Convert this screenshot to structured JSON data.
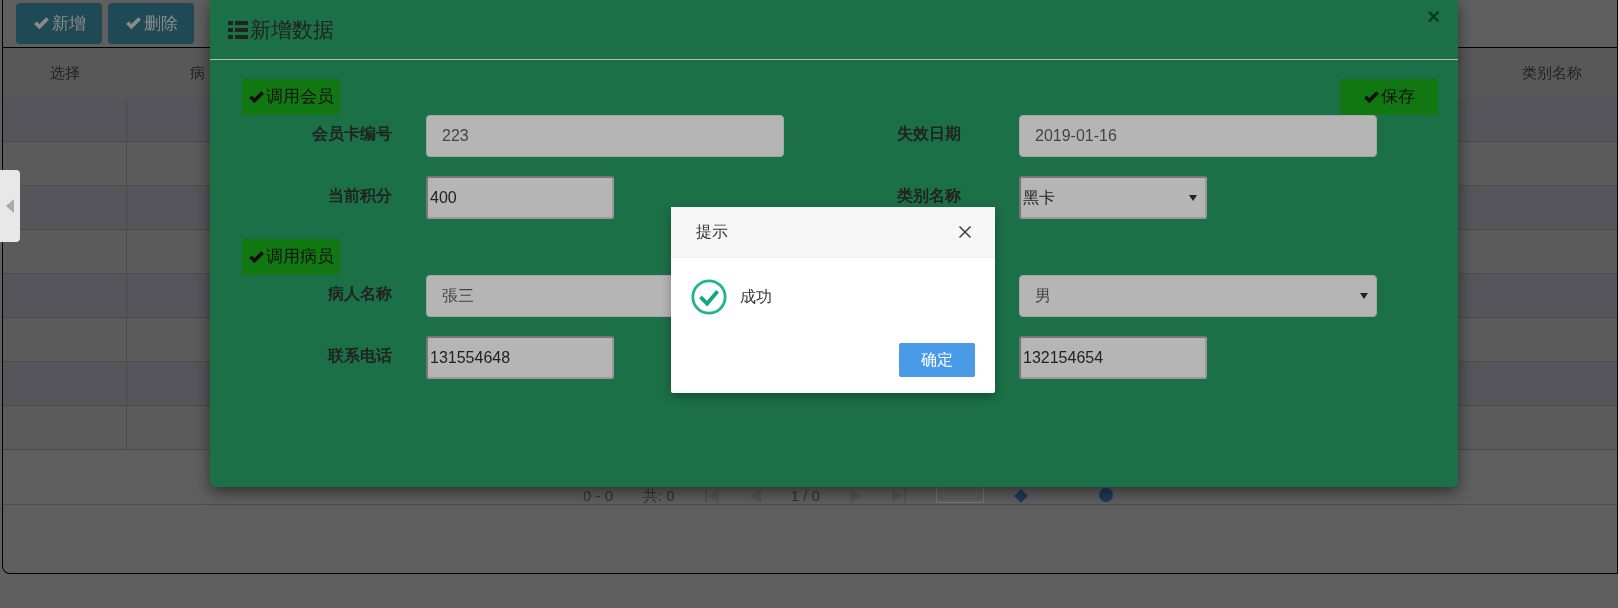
{
  "toolbar": {
    "buttons": [
      "新增",
      "删除"
    ]
  },
  "table": {
    "columns": [
      "选择",
      "病",
      "类别名称"
    ]
  },
  "pagination": {
    "range": "0 - 0",
    "total": "共: 0",
    "page": "1 / 0"
  },
  "modal": {
    "title": "新增数据",
    "close": "×",
    "save_button": "保存",
    "sections": [
      {
        "button": "调用会员",
        "rows": [
          [
            {
              "label": "会员卡编号",
              "kind": "text",
              "value": "223"
            },
            {
              "label": "失效日期",
              "kind": "text",
              "value": "2019-01-16"
            }
          ],
          [
            {
              "label": "当前积分",
              "kind": "native-text",
              "value": "400"
            },
            {
              "label": "类别名称",
              "kind": "native-select",
              "value": "黑卡"
            }
          ]
        ]
      },
      {
        "button": "调用病员",
        "rows": [
          [
            {
              "label": "病人名称",
              "kind": "text",
              "value": "張三"
            },
            {
              "kind": "select",
              "value": "男"
            }
          ],
          [
            {
              "label": "联系电话",
              "kind": "native-text",
              "value": "131554648"
            },
            {
              "kind": "native-text",
              "value": "132154654"
            }
          ]
        ]
      }
    ]
  },
  "dialog": {
    "title": "提示",
    "message": "成功",
    "ok_button": "确定"
  }
}
